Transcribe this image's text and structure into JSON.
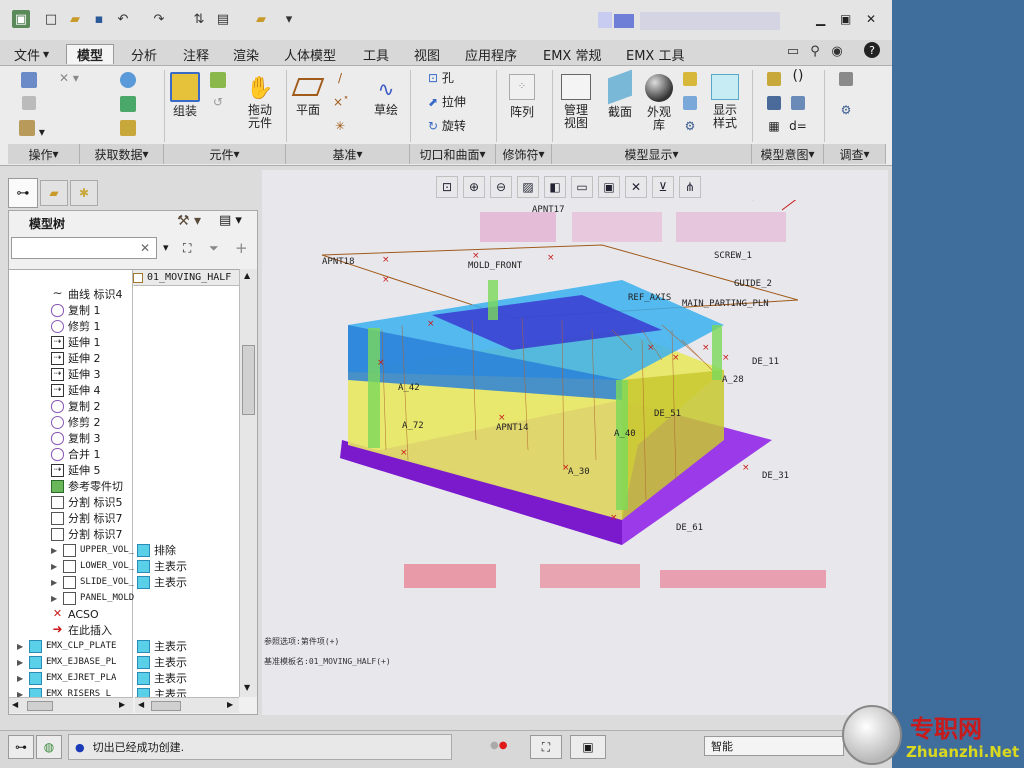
{
  "ribbon_tabs": [
    "文件",
    "模型",
    "分析",
    "注释",
    "渲染",
    "人体模型",
    "工具",
    "视图",
    "应用程序",
    "EMX 常规",
    "EMX 工具"
  ],
  "ribbon": {
    "assemble": "组装",
    "drag": "拖动元件",
    "plane": "平面",
    "sketch": "草绘",
    "hole": "孔",
    "extrude": "拉伸",
    "revolve": "旋转",
    "pattern": "阵列",
    "manage_views": "管理视图",
    "section": "截面",
    "appearance": "外观库",
    "display_style": "显示样式",
    "groups": [
      "操作",
      "获取数据",
      "元件",
      "基准",
      "切口和曲面",
      "修饰符",
      "模型显示",
      "模型意图",
      "调查"
    ]
  },
  "tree": {
    "title": "模型树",
    "root": "01_MOVING_HALF",
    "items": [
      {
        "icon": "~",
        "label": "曲线 标识4"
      },
      {
        "icon": "c",
        "label": "复制 1"
      },
      {
        "icon": "t",
        "label": "修剪 1"
      },
      {
        "icon": "e",
        "label": "延伸 1"
      },
      {
        "icon": "e",
        "label": "延伸 2"
      },
      {
        "icon": "e",
        "label": "延伸 3"
      },
      {
        "icon": "e",
        "label": "延伸 4"
      },
      {
        "icon": "c",
        "label": "复制 2"
      },
      {
        "icon": "t",
        "label": "修剪 2"
      },
      {
        "icon": "c",
        "label": "复制 3"
      },
      {
        "icon": "m",
        "label": "合并 1"
      },
      {
        "icon": "e",
        "label": "延伸 5"
      },
      {
        "icon": "r",
        "label": "参考零件切"
      },
      {
        "icon": "s",
        "label": "分割 标识5"
      },
      {
        "icon": "s",
        "label": "分割 标识7"
      },
      {
        "icon": "s",
        "label": "分割 标识7"
      },
      {
        "icon": "v",
        "label": "UPPER_VOL_",
        "extra": "排除"
      },
      {
        "icon": "v",
        "label": "LOWER_VOL_",
        "extra": "主表示"
      },
      {
        "icon": "v",
        "label": "SLIDE_VOL_",
        "extra": "主表示"
      },
      {
        "icon": "v",
        "label": "PANEL_MOLD"
      },
      {
        "icon": "x",
        "label": "ACSO"
      },
      {
        "icon": "→",
        "label": "在此插入"
      },
      {
        "icon": "b",
        "label": "EMX_CLP_PLATE",
        "extra": "主表示"
      },
      {
        "icon": "b",
        "label": "EMX_EJBASE_PL",
        "extra": "主表示"
      },
      {
        "icon": "b",
        "label": "EMX_EJRET_PLA",
        "extra": "主表示"
      },
      {
        "icon": "b",
        "label": "EMX_RISERS_L",
        "extra": "主表示"
      }
    ]
  },
  "viewport": {
    "labels": [
      "APNT18",
      "APNT17",
      "MOLD_FRONT",
      "SCREW_1",
      "GUIDE_2",
      "REF_AXIS",
      "MAIN_PARTING_PLN",
      "A_42",
      "A_72",
      "A_30",
      "A_40",
      "A_28",
      "APNT14",
      "DE_51",
      "DE_61",
      "DE_31",
      "DE_11"
    ],
    "info1": "参照选项:第件项(+)",
    "info2": "基准模板名:01_MOVING_HALF(+)"
  },
  "status": {
    "message": "切出已经成功创建.",
    "filter": "智能"
  },
  "watermark": {
    "cn": "专职网",
    "en": "Zhuanzhi.Net"
  }
}
